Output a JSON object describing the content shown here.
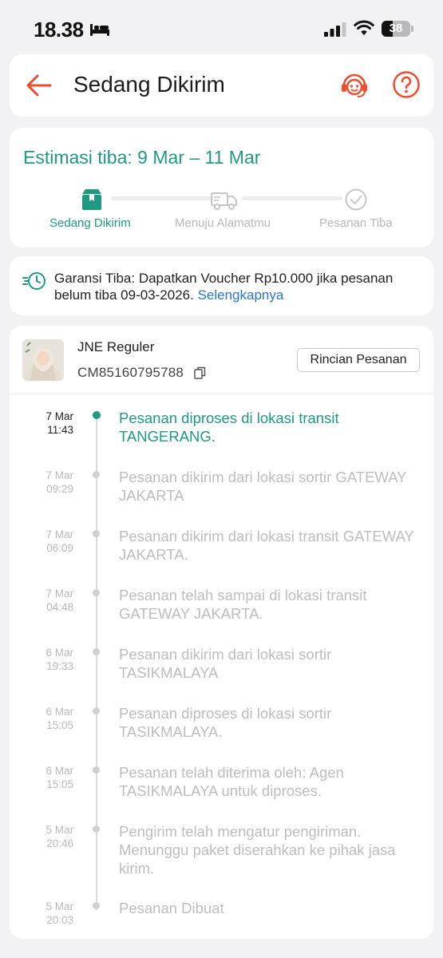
{
  "status_bar": {
    "time": "18.38",
    "battery": "38",
    "battery_level": 0.38
  },
  "header": {
    "title": "Sedang Dikirim"
  },
  "estimate": {
    "title": "Estimasi tiba: 9 Mar – 11 Mar",
    "steps": [
      {
        "label": "Sedang Dikirim",
        "state": "active",
        "icon": "box-icon"
      },
      {
        "label": "Menuju Alamatmu",
        "state": "pending",
        "icon": "truck-icon"
      },
      {
        "label": "Pesanan Tiba",
        "state": "pending",
        "icon": "check-circle-icon"
      }
    ]
  },
  "guarantee": {
    "text": "Garansi Tiba: Dapatkan Voucher Rp10.000 jika pesanan belum tiba 09-03-2026. ",
    "link": "Selengkapnya"
  },
  "shipment": {
    "courier": "JNE Reguler",
    "tracking_number": "CM85160795788",
    "detail_button": "Rincian Pesanan"
  },
  "timeline": [
    {
      "date": "7 Mar",
      "time": "11:43",
      "text": "Pesanan diproses di lokasi transit TANGERANG.",
      "active": true
    },
    {
      "date": "7 Mar",
      "time": "09:29",
      "text": "Pesanan dikirim dari lokasi sortir GATEWAY JAKARTA",
      "active": false
    },
    {
      "date": "7 Mar",
      "time": "06:09",
      "text": "Pesanan dikirim dari lokasi transit GATEWAY JAKARTA.",
      "active": false
    },
    {
      "date": "7 Mar",
      "time": "04:48",
      "text": "Pesanan telah sampai di lokasi transit GATEWAY JAKARTA.",
      "active": false
    },
    {
      "date": "6 Mar",
      "time": "19:33",
      "text": "Pesanan dikirim dari lokasi sortir TASIKMALAYA",
      "active": false
    },
    {
      "date": "6 Mar",
      "time": "15:05",
      "text": "Pesanan diproses di lokasi sortir TASIKMALAYA.",
      "active": false
    },
    {
      "date": "6 Mar",
      "time": "15:05",
      "text": "Pesanan telah diterima oleh: Agen TASIKMALAYA untuk diproses.",
      "active": false
    },
    {
      "date": "5 Mar",
      "time": "20:46",
      "text": "Pengirim telah mengatur pengiriman. Menunggu paket diserahkan ke pihak jasa kirim.",
      "active": false
    },
    {
      "date": "5 Mar",
      "time": "20:03",
      "text": "Pesanan Dibuat",
      "active": false
    }
  ],
  "colors": {
    "accent": "#1e9a83",
    "brand": "#ee4d2d",
    "link": "#2a76c8"
  }
}
